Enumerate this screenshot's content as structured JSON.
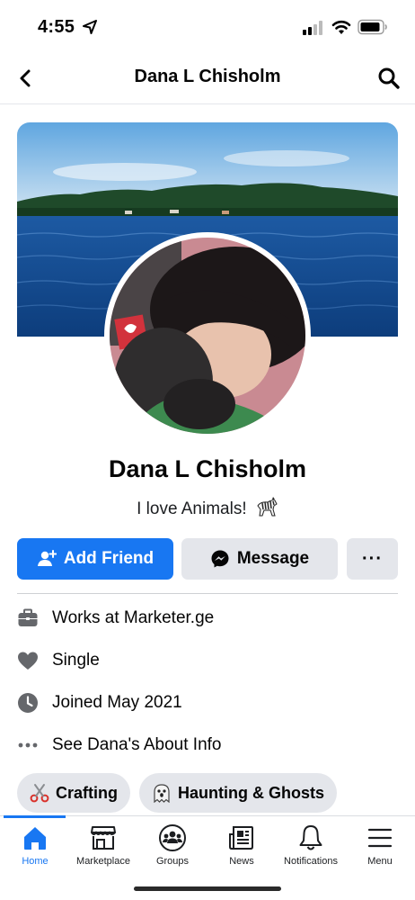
{
  "status_bar": {
    "time": "4:55"
  },
  "header": {
    "title": "Dana L Chisholm"
  },
  "profile": {
    "name": "Dana L Chisholm",
    "bio": "I love Animals!"
  },
  "actions": {
    "add_friend": "Add Friend",
    "message": "Message",
    "more": "···"
  },
  "info": {
    "work_prefix": "Works at ",
    "work_place": "Marketer.ge",
    "relationship": "Single",
    "joined": "Joined May 2021",
    "about": "See Dana's About Info"
  },
  "hobbies": [
    "Crafting",
    "Haunting & Ghosts"
  ],
  "nav": [
    {
      "label": "Home",
      "icon": "home-icon",
      "active": true
    },
    {
      "label": "Marketplace",
      "icon": "marketplace-icon",
      "active": false
    },
    {
      "label": "Groups",
      "icon": "groups-icon",
      "active": false
    },
    {
      "label": "News",
      "icon": "news-icon",
      "active": false
    },
    {
      "label": "Notifications",
      "icon": "bell-icon",
      "active": false
    },
    {
      "label": "Menu",
      "icon": "menu-icon",
      "active": false
    }
  ],
  "colors": {
    "accent": "#1877f2",
    "secondary_button": "#e4e6eb",
    "icon_gray": "#65676b"
  }
}
